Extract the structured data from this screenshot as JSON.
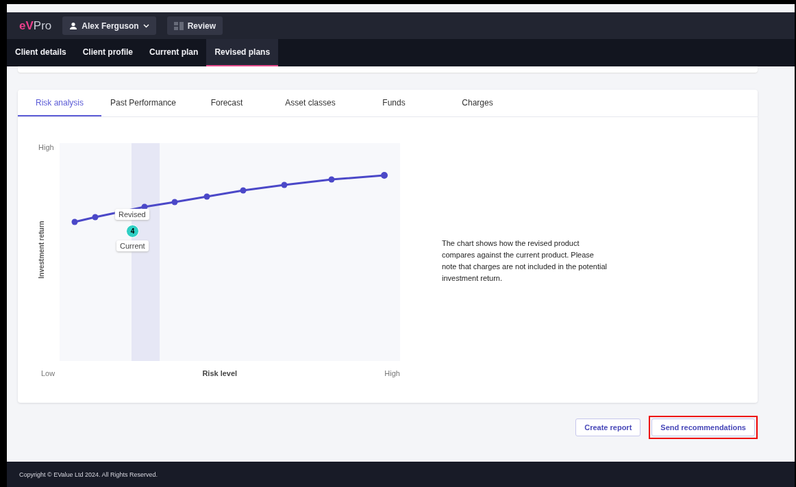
{
  "header": {
    "logo": {
      "accent": "eV",
      "rest": "Pro"
    },
    "user": "Alex Ferguson",
    "review": "Review"
  },
  "nav_tabs": [
    {
      "label": "Client details",
      "selected": false
    },
    {
      "label": "Client profile",
      "selected": false
    },
    {
      "label": "Current plan",
      "selected": false
    },
    {
      "label": "Revised plans",
      "selected": true
    }
  ],
  "analysis_tabs": [
    {
      "label": "Risk analysis",
      "selected": true
    },
    {
      "label": "Past Performance",
      "selected": false
    },
    {
      "label": "Forecast",
      "selected": false
    },
    {
      "label": "Asset classes",
      "selected": false
    },
    {
      "label": "Funds",
      "selected": false
    },
    {
      "label": "Charges",
      "selected": false
    }
  ],
  "chart": {
    "y_top": "High",
    "ylabel": "Investment return",
    "x_left": "Low",
    "xlabel": "Risk level",
    "x_right": "High",
    "revised_label": "Revised",
    "current_label": "Current",
    "marker": "4"
  },
  "description": "The chart shows how the revised product compares against the current product. Please note that charges are not included in the potential investment return.",
  "buttons": [
    {
      "label": "Create report",
      "highlighted": false
    },
    {
      "label": "Send recommendations",
      "highlighted": true
    }
  ],
  "footer": "Copyright © EValue Ltd 2024. All Rights Reserved."
}
